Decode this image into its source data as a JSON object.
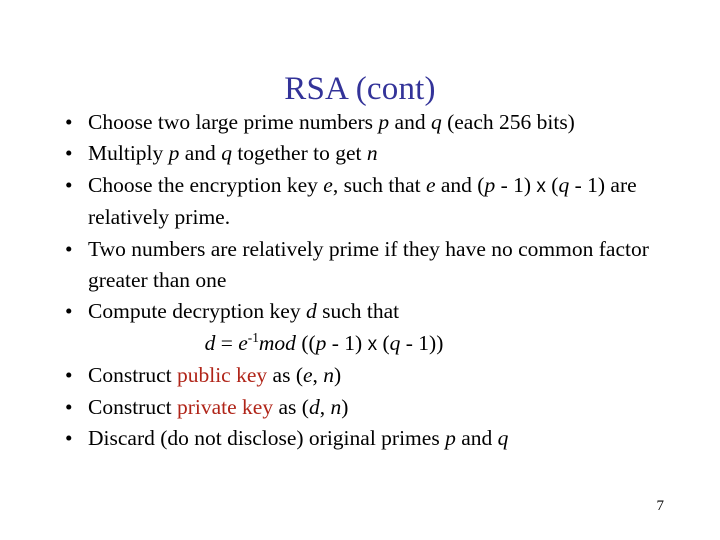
{
  "slide": {
    "title": "RSA (cont)",
    "title_color": "#333399",
    "background_color": "#FFFFFF",
    "body_text_color": "#000000",
    "accent_color": "#B02418",
    "page_number": "7",
    "bullet_glyph": "•",
    "multiply_symbol": "x",
    "bullets": [
      {
        "name": "choose-primes",
        "plain_text": "Choose two large prime numbers p and q (each 256 bits)",
        "segments": [
          {
            "t": "Choose two large prime numbers ",
            "style": "normal"
          },
          {
            "t": "p",
            "style": "italic"
          },
          {
            "t": " and ",
            "style": "normal"
          },
          {
            "t": "q",
            "style": "italic"
          },
          {
            "t": " (each 256 bits)",
            "style": "normal"
          }
        ]
      },
      {
        "name": "multiply-to-get-n",
        "plain_text": "Multiply p and q together to get n",
        "segments": [
          {
            "t": "Multiply ",
            "style": "normal"
          },
          {
            "t": "p",
            "style": "italic"
          },
          {
            "t": " and ",
            "style": "normal"
          },
          {
            "t": "q",
            "style": "italic"
          },
          {
            "t": " together to get ",
            "style": "normal"
          },
          {
            "t": "n",
            "style": "italic"
          }
        ]
      },
      {
        "name": "choose-encryption-key",
        "plain_text": "Choose the encryption key e, such that e and (p - 1) x (q - 1) are relatively prime.",
        "segments": [
          {
            "t": "Choose the encryption key ",
            "style": "normal"
          },
          {
            "t": "e",
            "style": "italic"
          },
          {
            "t": ", such that ",
            "style": "normal"
          },
          {
            "t": "e",
            "style": "italic"
          },
          {
            "t": " and (",
            "style": "normal"
          },
          {
            "t": "p",
            "style": "italic"
          },
          {
            "t": " - 1) ",
            "style": "normal"
          },
          {
            "t": "x",
            "style": "times"
          },
          {
            "t": " (",
            "style": "normal"
          },
          {
            "t": "q",
            "style": "italic"
          },
          {
            "t": " - 1) are relatively prime.",
            "style": "normal"
          }
        ]
      },
      {
        "name": "relatively-prime-definition",
        "plain_text": "Two numbers are relatively prime if they have no common factor greater than one",
        "segments": [
          {
            "t": "Two numbers are relatively prime if they have no common factor greater than one",
            "style": "normal"
          }
        ]
      },
      {
        "name": "compute-decryption-key",
        "plain_text": "Compute decryption key d such that",
        "segments": [
          {
            "t": "Compute decryption key ",
            "style": "normal"
          },
          {
            "t": "d",
            "style": "italic"
          },
          {
            "t": " such that",
            "style": "normal"
          }
        ]
      },
      {
        "name": "construct-public-key",
        "plain_text": "Construct public key as (e, n)",
        "segments": [
          {
            "t": "Construct ",
            "style": "normal"
          },
          {
            "t": "public key",
            "style": "red"
          },
          {
            "t": " as (",
            "style": "normal"
          },
          {
            "t": "e",
            "style": "italic"
          },
          {
            "t": ", ",
            "style": "normal"
          },
          {
            "t": "n",
            "style": "italic"
          },
          {
            "t": ")",
            "style": "normal"
          }
        ]
      },
      {
        "name": "construct-private-key",
        "plain_text": "Construct private key as (d, n)",
        "segments": [
          {
            "t": "Construct ",
            "style": "normal"
          },
          {
            "t": "private key",
            "style": "red"
          },
          {
            "t": " as (",
            "style": "normal"
          },
          {
            "t": "d",
            "style": "italic"
          },
          {
            "t": ", ",
            "style": "normal"
          },
          {
            "t": "n",
            "style": "italic"
          },
          {
            "t": ")",
            "style": "normal"
          }
        ]
      },
      {
        "name": "discard-primes",
        "plain_text": "Discard (do not disclose) original primes p  and q",
        "segments": [
          {
            "t": "Discard (do not disclose) original primes ",
            "style": "normal"
          },
          {
            "t": "p",
            "style": "italic"
          },
          {
            "t": "  and ",
            "style": "normal"
          },
          {
            "t": "q",
            "style": "italic"
          }
        ]
      }
    ],
    "formula": {
      "name": "decryption-key-formula",
      "plain_text": "d = e-1mod ((p - 1) x (q - 1))",
      "segments": [
        {
          "t": "d",
          "style": "italic"
        },
        {
          "t": " = ",
          "style": "normal"
        },
        {
          "t": "e",
          "style": "italic"
        },
        {
          "t": "-1",
          "style": "superscript"
        },
        {
          "t": "mod",
          "style": "italic"
        },
        {
          "t": " ((",
          "style": "normal"
        },
        {
          "t": "p",
          "style": "italic"
        },
        {
          "t": " - 1) ",
          "style": "normal"
        },
        {
          "t": "x",
          "style": "times"
        },
        {
          "t": " (",
          "style": "normal"
        },
        {
          "t": "q",
          "style": "italic"
        },
        {
          "t": " - 1))",
          "style": "normal"
        }
      ]
    }
  }
}
